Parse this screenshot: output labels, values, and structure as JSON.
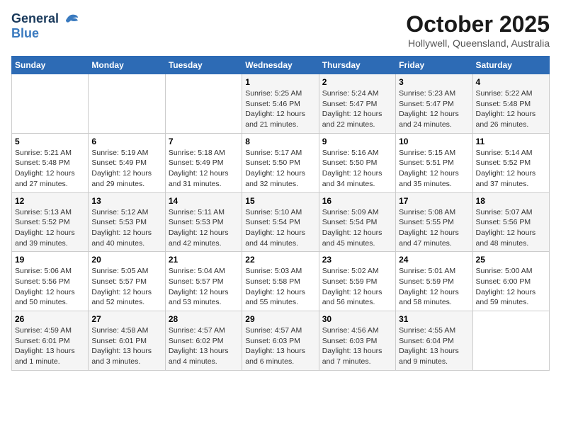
{
  "header": {
    "logo_line1": "General",
    "logo_line2": "Blue",
    "month": "October 2025",
    "location": "Hollywell, Queensland, Australia"
  },
  "weekdays": [
    "Sunday",
    "Monday",
    "Tuesday",
    "Wednesday",
    "Thursday",
    "Friday",
    "Saturday"
  ],
  "weeks": [
    [
      {
        "day": "",
        "info": ""
      },
      {
        "day": "",
        "info": ""
      },
      {
        "day": "",
        "info": ""
      },
      {
        "day": "1",
        "info": "Sunrise: 5:25 AM\nSunset: 5:46 PM\nDaylight: 12 hours\nand 21 minutes."
      },
      {
        "day": "2",
        "info": "Sunrise: 5:24 AM\nSunset: 5:47 PM\nDaylight: 12 hours\nand 22 minutes."
      },
      {
        "day": "3",
        "info": "Sunrise: 5:23 AM\nSunset: 5:47 PM\nDaylight: 12 hours\nand 24 minutes."
      },
      {
        "day": "4",
        "info": "Sunrise: 5:22 AM\nSunset: 5:48 PM\nDaylight: 12 hours\nand 26 minutes."
      }
    ],
    [
      {
        "day": "5",
        "info": "Sunrise: 5:21 AM\nSunset: 5:48 PM\nDaylight: 12 hours\nand 27 minutes."
      },
      {
        "day": "6",
        "info": "Sunrise: 5:19 AM\nSunset: 5:49 PM\nDaylight: 12 hours\nand 29 minutes."
      },
      {
        "day": "7",
        "info": "Sunrise: 5:18 AM\nSunset: 5:49 PM\nDaylight: 12 hours\nand 31 minutes."
      },
      {
        "day": "8",
        "info": "Sunrise: 5:17 AM\nSunset: 5:50 PM\nDaylight: 12 hours\nand 32 minutes."
      },
      {
        "day": "9",
        "info": "Sunrise: 5:16 AM\nSunset: 5:50 PM\nDaylight: 12 hours\nand 34 minutes."
      },
      {
        "day": "10",
        "info": "Sunrise: 5:15 AM\nSunset: 5:51 PM\nDaylight: 12 hours\nand 35 minutes."
      },
      {
        "day": "11",
        "info": "Sunrise: 5:14 AM\nSunset: 5:52 PM\nDaylight: 12 hours\nand 37 minutes."
      }
    ],
    [
      {
        "day": "12",
        "info": "Sunrise: 5:13 AM\nSunset: 5:52 PM\nDaylight: 12 hours\nand 39 minutes."
      },
      {
        "day": "13",
        "info": "Sunrise: 5:12 AM\nSunset: 5:53 PM\nDaylight: 12 hours\nand 40 minutes."
      },
      {
        "day": "14",
        "info": "Sunrise: 5:11 AM\nSunset: 5:53 PM\nDaylight: 12 hours\nand 42 minutes."
      },
      {
        "day": "15",
        "info": "Sunrise: 5:10 AM\nSunset: 5:54 PM\nDaylight: 12 hours\nand 44 minutes."
      },
      {
        "day": "16",
        "info": "Sunrise: 5:09 AM\nSunset: 5:54 PM\nDaylight: 12 hours\nand 45 minutes."
      },
      {
        "day": "17",
        "info": "Sunrise: 5:08 AM\nSunset: 5:55 PM\nDaylight: 12 hours\nand 47 minutes."
      },
      {
        "day": "18",
        "info": "Sunrise: 5:07 AM\nSunset: 5:56 PM\nDaylight: 12 hours\nand 48 minutes."
      }
    ],
    [
      {
        "day": "19",
        "info": "Sunrise: 5:06 AM\nSunset: 5:56 PM\nDaylight: 12 hours\nand 50 minutes."
      },
      {
        "day": "20",
        "info": "Sunrise: 5:05 AM\nSunset: 5:57 PM\nDaylight: 12 hours\nand 52 minutes."
      },
      {
        "day": "21",
        "info": "Sunrise: 5:04 AM\nSunset: 5:57 PM\nDaylight: 12 hours\nand 53 minutes."
      },
      {
        "day": "22",
        "info": "Sunrise: 5:03 AM\nSunset: 5:58 PM\nDaylight: 12 hours\nand 55 minutes."
      },
      {
        "day": "23",
        "info": "Sunrise: 5:02 AM\nSunset: 5:59 PM\nDaylight: 12 hours\nand 56 minutes."
      },
      {
        "day": "24",
        "info": "Sunrise: 5:01 AM\nSunset: 5:59 PM\nDaylight: 12 hours\nand 58 minutes."
      },
      {
        "day": "25",
        "info": "Sunrise: 5:00 AM\nSunset: 6:00 PM\nDaylight: 12 hours\nand 59 minutes."
      }
    ],
    [
      {
        "day": "26",
        "info": "Sunrise: 4:59 AM\nSunset: 6:01 PM\nDaylight: 13 hours\nand 1 minute."
      },
      {
        "day": "27",
        "info": "Sunrise: 4:58 AM\nSunset: 6:01 PM\nDaylight: 13 hours\nand 3 minutes."
      },
      {
        "day": "28",
        "info": "Sunrise: 4:57 AM\nSunset: 6:02 PM\nDaylight: 13 hours\nand 4 minutes."
      },
      {
        "day": "29",
        "info": "Sunrise: 4:57 AM\nSunset: 6:03 PM\nDaylight: 13 hours\nand 6 minutes."
      },
      {
        "day": "30",
        "info": "Sunrise: 4:56 AM\nSunset: 6:03 PM\nDaylight: 13 hours\nand 7 minutes."
      },
      {
        "day": "31",
        "info": "Sunrise: 4:55 AM\nSunset: 6:04 PM\nDaylight: 13 hours\nand 9 minutes."
      },
      {
        "day": "",
        "info": ""
      }
    ]
  ]
}
